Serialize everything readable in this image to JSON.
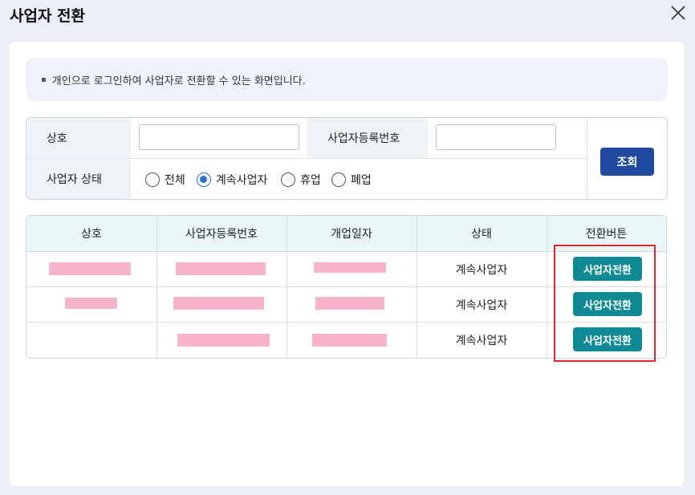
{
  "dialog": {
    "title": "사업자 전환",
    "close_icon": "close-icon"
  },
  "notice": {
    "bullet": "▪",
    "text": "개인으로 로그인하여 사업자로 전환할 수 있는 화면입니다."
  },
  "search": {
    "name_label": "상호",
    "name_value": "",
    "regno_label": "사업자등록번호",
    "regno_value": "",
    "status_label": "사업자 상태",
    "status_options": [
      "전체",
      "계속사업자",
      "휴업",
      "폐업"
    ],
    "status_selected": "계속사업자",
    "search_button": "조회"
  },
  "table": {
    "columns": [
      "상호",
      "사업자등록번호",
      "개업일자",
      "상태",
      "전환버튼"
    ],
    "rows": [
      {
        "name": "",
        "regno": "",
        "open_date": "",
        "status": "계속사업자",
        "action": "사업자전환"
      },
      {
        "name": "",
        "regno": "",
        "open_date": "",
        "status": "계속사업자",
        "action": "사업자전환"
      },
      {
        "name": "",
        "regno": "",
        "open_date": "",
        "status": "계속사업자",
        "action": "사업자전환"
      }
    ]
  },
  "colors": {
    "primary": "#1f4aa0",
    "teal": "#0f8a94",
    "highlight": "#e3262d",
    "redaction": "#f8b4cd"
  }
}
